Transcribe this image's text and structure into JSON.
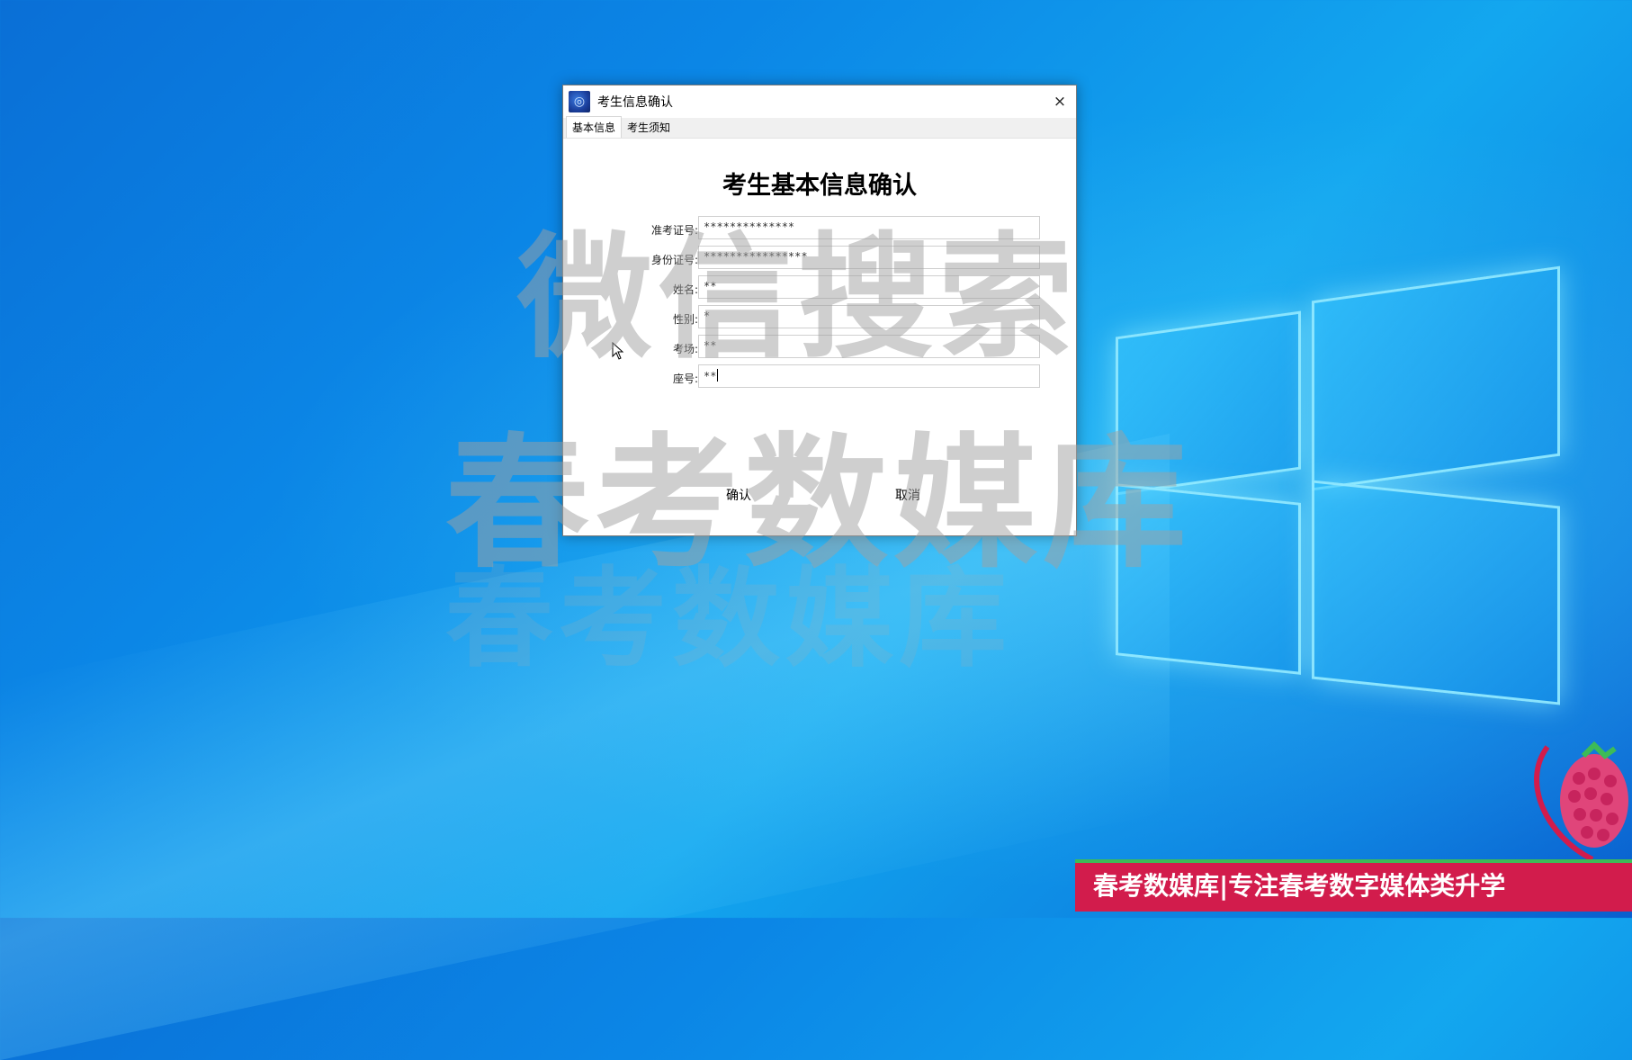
{
  "window": {
    "title": "考生信息确认",
    "close_label": "×"
  },
  "tabs": [
    {
      "label": "基本信息",
      "active": true
    },
    {
      "label": "考生须知",
      "active": false
    }
  ],
  "form": {
    "heading": "考生基本信息确认",
    "fields": [
      {
        "label": "准考证号:",
        "value": "**************"
      },
      {
        "label": "身份证号:",
        "value": "****************"
      },
      {
        "label": "姓名:",
        "value": "**"
      },
      {
        "label": "性别:",
        "value": "*"
      },
      {
        "label": "考场:",
        "value": "**"
      },
      {
        "label": "座号:",
        "value": "**"
      }
    ],
    "confirm_label": "确认",
    "cancel_label": "取消"
  },
  "watermark": {
    "line1": "微信搜索",
    "line2": "春考数媒库",
    "line3": "春考数媒库"
  },
  "banner": {
    "text": "春考数媒库|专注春考数字媒体类升学"
  },
  "colors": {
    "banner_bg": "#d21c4c",
    "banner_stripe": "#3dbb57",
    "desktop_bg": "#0b86e6"
  }
}
